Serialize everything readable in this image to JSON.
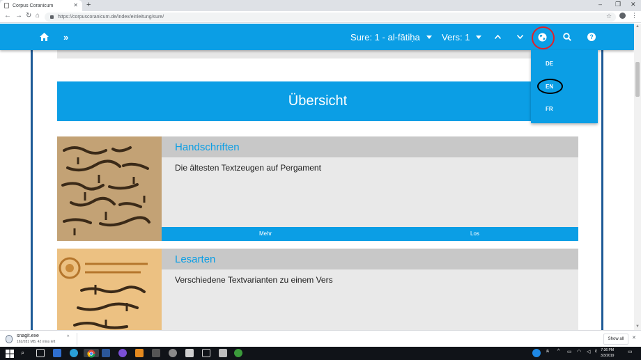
{
  "browser": {
    "tab_title": "Corpus Coranicum",
    "new_tab": "+",
    "url": "https://corpuscoranicum.de/index/einleitung/sure/",
    "window_controls": [
      "–",
      "❐",
      "✕"
    ]
  },
  "site": {
    "sura_label": "Sure: 1 - al-fātiḥa",
    "verse_label": "Vers: 1",
    "languages": [
      "DE",
      "EN",
      "FR"
    ],
    "selected_language_highlight": "EN"
  },
  "main": {
    "overview_title": "Übersicht",
    "cards": [
      {
        "title": "Handschriften",
        "description": "Die ältesten Textzeugen auf Pergament",
        "action_more": "Mehr",
        "action_go": "Los"
      },
      {
        "title": "Lesarten",
        "description": "Verschiedene Textvarianten zu einem Vers"
      }
    ]
  },
  "download_shelf": {
    "file_name": "snagit.exe",
    "file_meta": "162/281 MB, 42 mins left",
    "show_all": "Show all"
  },
  "taskbar": {
    "time": "7:36 PM",
    "date": "3/3/2019"
  },
  "colors": {
    "accent_blue": "#0b9ee5",
    "annotation_red": "#e0202a",
    "annotation_black": "#000000",
    "card_gray": "#e9e9e9",
    "title_bar_gray": "#c8c8c8"
  }
}
